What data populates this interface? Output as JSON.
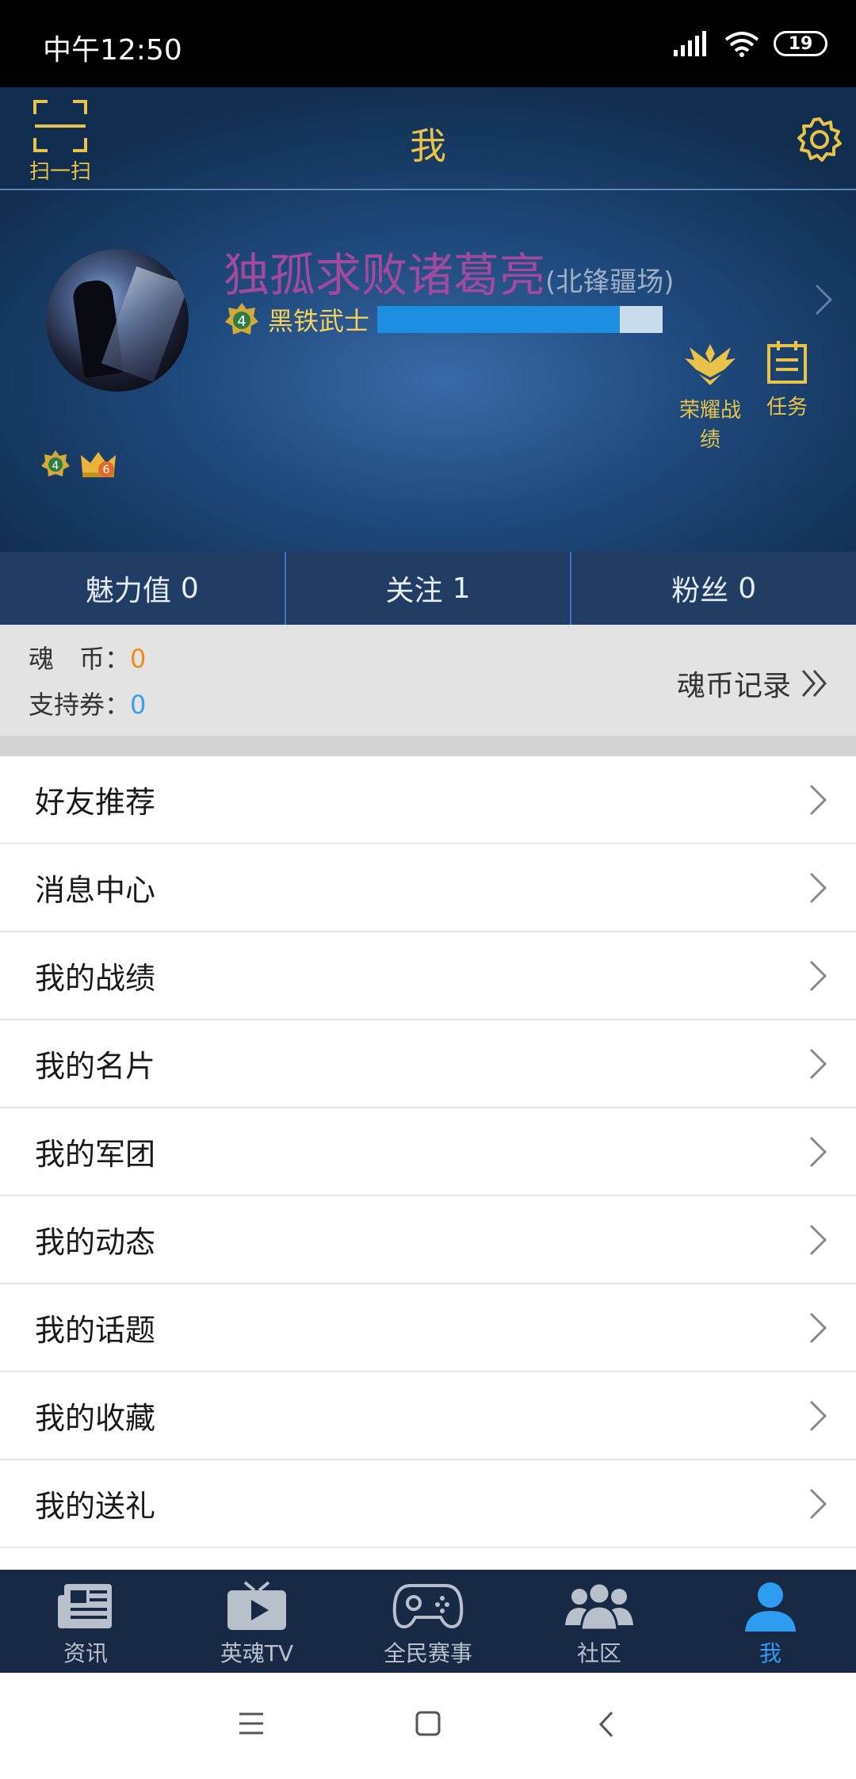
{
  "status_bar": {
    "time": "中午12:50",
    "battery": "19"
  },
  "header": {
    "scan_label": "扫一扫",
    "title": "我",
    "profile": {
      "name": "独孤求败诸葛亮",
      "server": "(北锋疆场)",
      "rank_level": "4",
      "rank_name": "黑铁武士",
      "xp_progress": 0.85,
      "badge_level": "4",
      "crown_level": "6"
    },
    "honor_label": "荣耀战绩",
    "task_label": "任务"
  },
  "stats": [
    {
      "label": "魅力值",
      "value": "0"
    },
    {
      "label": "关注",
      "value": "1"
    },
    {
      "label": "粉丝",
      "value": "0"
    }
  ],
  "wallet": {
    "coin_label": "魂　币：",
    "coin_value": "0",
    "voucher_label": "支持券：",
    "voucher_value": "0",
    "record_label": "魂币记录"
  },
  "menu": [
    {
      "label": "好友推荐"
    },
    {
      "label": "消息中心"
    },
    {
      "label": "我的战绩"
    },
    {
      "label": "我的名片"
    },
    {
      "label": "我的军团"
    },
    {
      "label": "我的动态"
    },
    {
      "label": "我的话题"
    },
    {
      "label": "我的收藏"
    },
    {
      "label": "我的送礼"
    }
  ],
  "bottom_nav": [
    {
      "label": "资讯",
      "icon": "news-icon",
      "active": false
    },
    {
      "label": "英魂TV",
      "icon": "tv-icon",
      "active": false
    },
    {
      "label": "全民赛事",
      "icon": "gamepad-icon",
      "active": false
    },
    {
      "label": "社区",
      "icon": "community-icon",
      "active": false
    },
    {
      "label": "我",
      "icon": "person-icon",
      "active": true
    }
  ],
  "colors": {
    "accent_gold": "#e9c24a",
    "name_purple": "#a14a9e",
    "active_blue": "#2e9cf0",
    "coin_orange": "#f28a1a",
    "voucher_blue": "#3a9ee9"
  }
}
